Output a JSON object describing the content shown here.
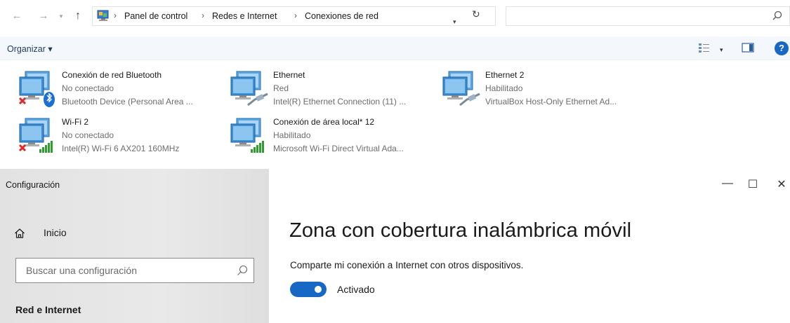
{
  "explorer": {
    "breadcrumb": [
      "Panel de control",
      "Redes e Internet",
      "Conexiones de red"
    ],
    "toolbar": {
      "organize_label": "Organizar ▾"
    },
    "connections": [
      {
        "name": "Conexión de red Bluetooth",
        "status": "No conectado",
        "device": "Bluetooth Device (Personal Area ...",
        "icon": "bluetooth-network-icon"
      },
      {
        "name": "Ethernet",
        "status": "Red",
        "device": "Intel(R) Ethernet Connection (11) ...",
        "icon": "ethernet-network-icon"
      },
      {
        "name": "Ethernet 2",
        "status": "Habilitado",
        "device": "VirtualBox Host-Only Ethernet Ad...",
        "icon": "ethernet-network-icon"
      },
      {
        "name": "Wi-Fi 2",
        "status": "No conectado",
        "device": "Intel(R) Wi-Fi 6 AX201 160MHz",
        "icon": "wifi-network-icon"
      },
      {
        "name": "Conexión de área local* 12",
        "status": "Habilitado",
        "device": "Microsoft Wi-Fi Direct Virtual Ada...",
        "icon": "wifi-network-icon"
      }
    ]
  },
  "settings": {
    "window_title": "Configuración",
    "home_label": "Inicio",
    "search_placeholder": "Buscar una configuración",
    "section_label": "Red e Internet",
    "page_title": "Zona con cobertura inalámbrica móvil",
    "description": "Comparte mi conexión a Internet con otros dispositivos.",
    "toggle_label": "Activado",
    "toggle_on": true
  },
  "colors": {
    "accent": "#1767c4",
    "disconnected_x": "#e0282c",
    "signal_green": "#2e9e2e"
  }
}
